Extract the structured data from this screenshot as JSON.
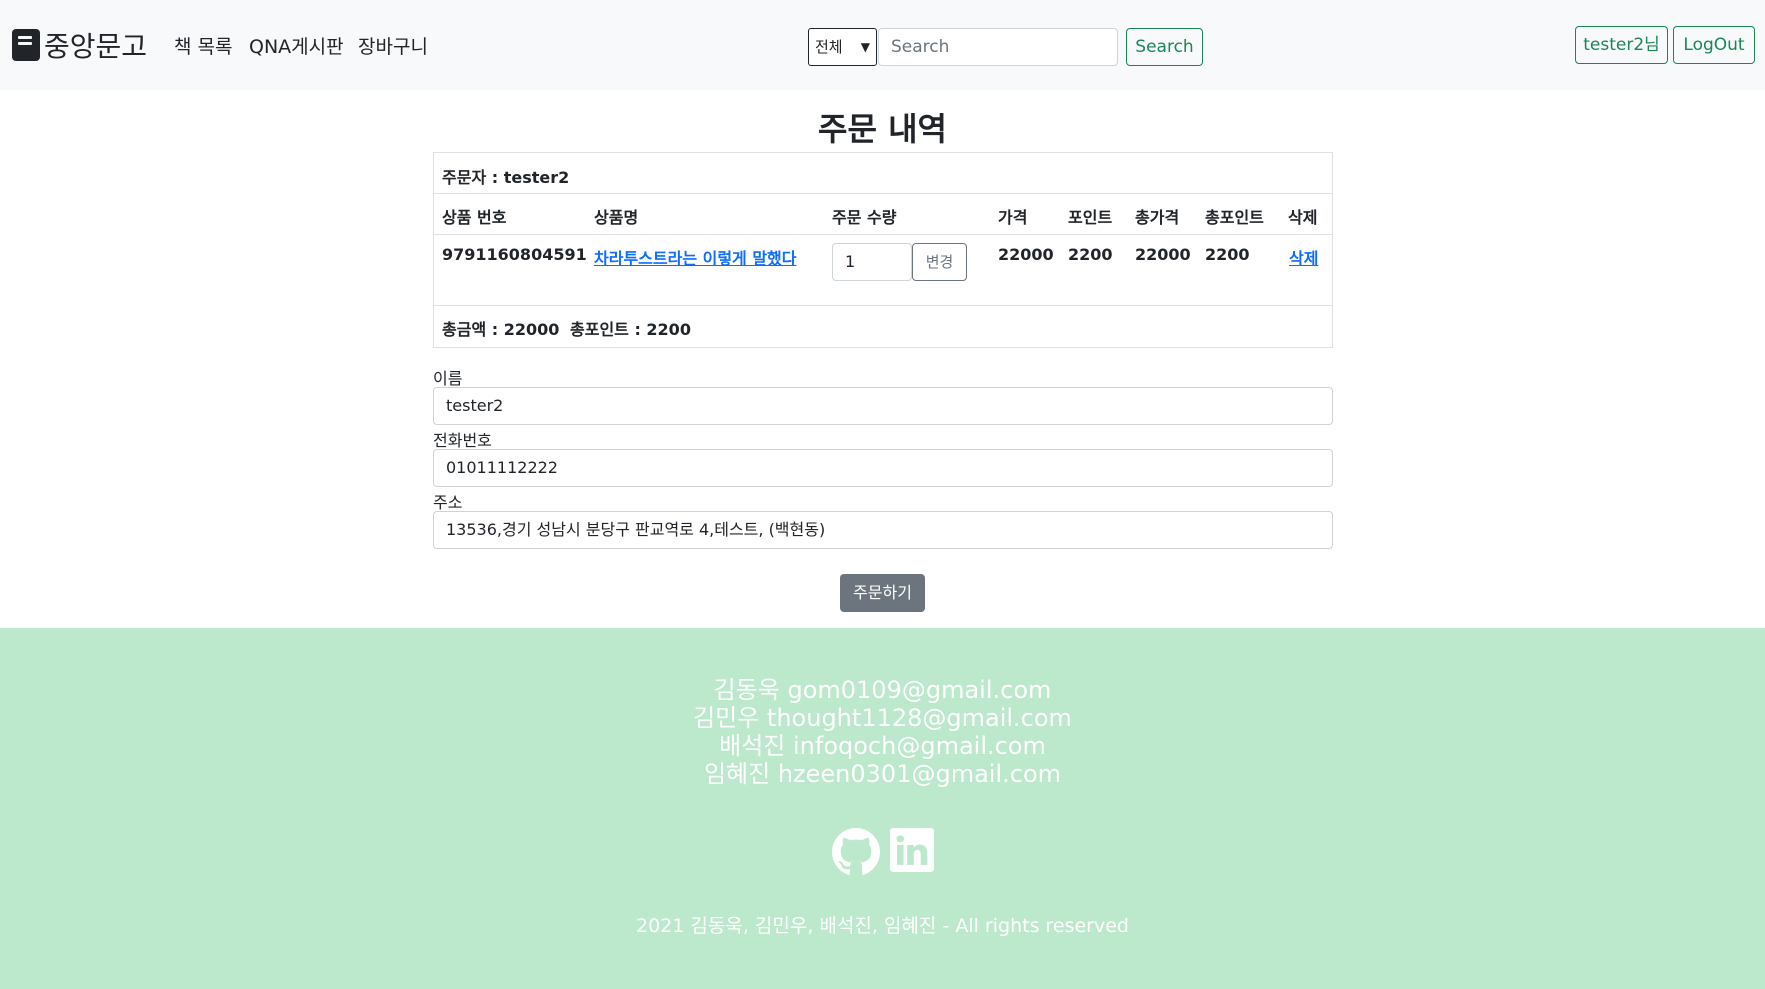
{
  "navbar": {
    "brand": "중앙문고",
    "links": [
      "책 목록",
      "QNA게시판",
      "장바구니"
    ],
    "search": {
      "category": "전체",
      "placeholder": "Search",
      "button": "Search"
    },
    "user_button": "tester2님",
    "logout_button": "LogOut"
  },
  "page": {
    "title": "주문 내역"
  },
  "order": {
    "orderer_label": "주문자 : tester2",
    "headers": [
      "상품 번호",
      "상품명",
      "주문 수량",
      "가격",
      "포인트",
      "총가격",
      "총포인트",
      "삭제"
    ],
    "items": [
      {
        "product_no": "9791160804591",
        "name": "차라투스트라는 이렇게 말했다",
        "quantity": "1",
        "change_label": "변경",
        "price": "22000",
        "point": "2200",
        "total_price": "22000",
        "total_point": "2200",
        "delete_label": "삭제"
      }
    ],
    "total_amount": "총금액 : 22000",
    "total_point": "총포인트 : 2200"
  },
  "form": {
    "name_label": "이름",
    "name_value": "tester2",
    "phone_label": "전화번호",
    "phone_value": "01011112222",
    "address_label": "주소",
    "address_value": "13536,경기 성남시 분당구 판교역로 4,테스트, (백현동)",
    "submit_label": "주문하기"
  },
  "footer": {
    "contacts": [
      "김동욱 gom0109@gmail.com",
      "김민우 thought1128@gmail.com",
      "배석진 infoqoch@gmail.com",
      "임혜진 hzeen0301@gmail.com"
    ],
    "icons": [
      "github-icon",
      "linkedin-icon"
    ],
    "copyright": "2021 김동욱, 김민우, 배석진, 임혜진 - All rights reserved"
  },
  "colors": {
    "accent": "#198754",
    "footer_bg": "#bce8cb",
    "link": "#0d6efd",
    "secondary": "#6c757d"
  }
}
